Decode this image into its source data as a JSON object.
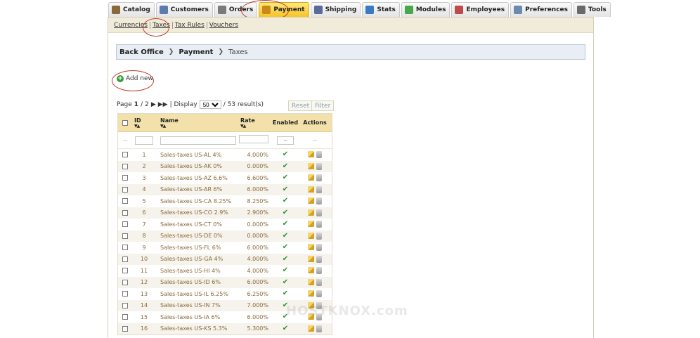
{
  "tabs": [
    {
      "label": "Catalog",
      "icon": "catalog-icon",
      "color": "#8b6a3a"
    },
    {
      "label": "Customers",
      "icon": "customers-icon",
      "color": "#5a7ab0"
    },
    {
      "label": "Orders",
      "icon": "orders-icon",
      "color": "#7a7a7a"
    },
    {
      "label": "Payment",
      "icon": "payment-icon",
      "color": "#c98a1a",
      "active": true
    },
    {
      "label": "Shipping",
      "icon": "shipping-icon",
      "color": "#5a6a9a"
    },
    {
      "label": "Stats",
      "icon": "stats-icon",
      "color": "#3a7ac0"
    },
    {
      "label": "Modules",
      "icon": "modules-icon",
      "color": "#4aa64a"
    },
    {
      "label": "Employees",
      "icon": "employees-icon",
      "color": "#c04a4a"
    },
    {
      "label": "Preferences",
      "icon": "preferences-icon",
      "color": "#6a8ab0"
    },
    {
      "label": "Tools",
      "icon": "tools-icon",
      "color": "#6a6a6a"
    }
  ],
  "subtabs": [
    "Currencies",
    "Taxes",
    "Tax Rules",
    "Vouchers"
  ],
  "breadcrumb": {
    "root": "Back Office",
    "section": "Payment",
    "page": "Taxes"
  },
  "add_new": "Add new",
  "pager": {
    "page_label": "Page",
    "current": "1",
    "total": "2",
    "display_label": "| Display",
    "per_page": "50",
    "results": "/ 53 result(s)"
  },
  "buttons": {
    "reset": "Reset",
    "filter": "Filter"
  },
  "table": {
    "headers": {
      "id": "ID",
      "name": "Name",
      "rate": "Rate",
      "enabled": "Enabled",
      "actions": "Actions"
    },
    "filter_placeholder": "--",
    "enabled_filter": "--",
    "rows": [
      {
        "id": "1",
        "name": "Sales-taxes US-AL 4%",
        "rate": "4.000%"
      },
      {
        "id": "2",
        "name": "Sales-taxes US-AK 0%",
        "rate": "0.000%"
      },
      {
        "id": "3",
        "name": "Sales-taxes US-AZ 6.6%",
        "rate": "6.600%"
      },
      {
        "id": "4",
        "name": "Sales-taxes US-AR 6%",
        "rate": "6.000%"
      },
      {
        "id": "5",
        "name": "Sales-taxes US-CA 8.25%",
        "rate": "8.250%"
      },
      {
        "id": "6",
        "name": "Sales-taxes US-CO 2.9%",
        "rate": "2.900%"
      },
      {
        "id": "7",
        "name": "Sales-taxes US-CT 0%",
        "rate": "0.000%"
      },
      {
        "id": "8",
        "name": "Sales-taxes US-DE 0%",
        "rate": "0.000%"
      },
      {
        "id": "9",
        "name": "Sales-taxes US-FL 6%",
        "rate": "6.000%"
      },
      {
        "id": "10",
        "name": "Sales-taxes US-GA 4%",
        "rate": "4.000%"
      },
      {
        "id": "11",
        "name": "Sales-taxes US-HI 4%",
        "rate": "4.000%"
      },
      {
        "id": "12",
        "name": "Sales-taxes US-ID 6%",
        "rate": "6.000%"
      },
      {
        "id": "13",
        "name": "Sales-taxes US-IL 6.25%",
        "rate": "6.250%"
      },
      {
        "id": "14",
        "name": "Sales-taxes US-IN 7%",
        "rate": "7.000%"
      },
      {
        "id": "15",
        "name": "Sales-taxes US-IA 6%",
        "rate": "6.000%"
      },
      {
        "id": "16",
        "name": "Sales-taxes US-KS 5.3%",
        "rate": "5.300%"
      }
    ]
  },
  "watermark": "HOSTKNOX.com"
}
